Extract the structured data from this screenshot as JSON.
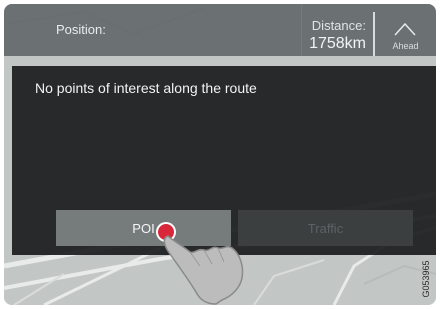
{
  "header": {
    "position_label": "Position:",
    "distance_label": "Distance:",
    "distance_value": "1758km",
    "ahead_label": "Ahead"
  },
  "panel": {
    "message": "No points of interest along the route"
  },
  "tabs": [
    {
      "label": "POI",
      "active": true
    },
    {
      "label": "Traffic",
      "active": false
    }
  ],
  "figure_ref": "G053965",
  "icons": {
    "ahead": "chevron-up-icon",
    "touch": "hand-pointer-icon"
  },
  "colors": {
    "tap_marker": "#d8263a",
    "panel_bg": "#161718",
    "active_button": "#767b7c"
  }
}
